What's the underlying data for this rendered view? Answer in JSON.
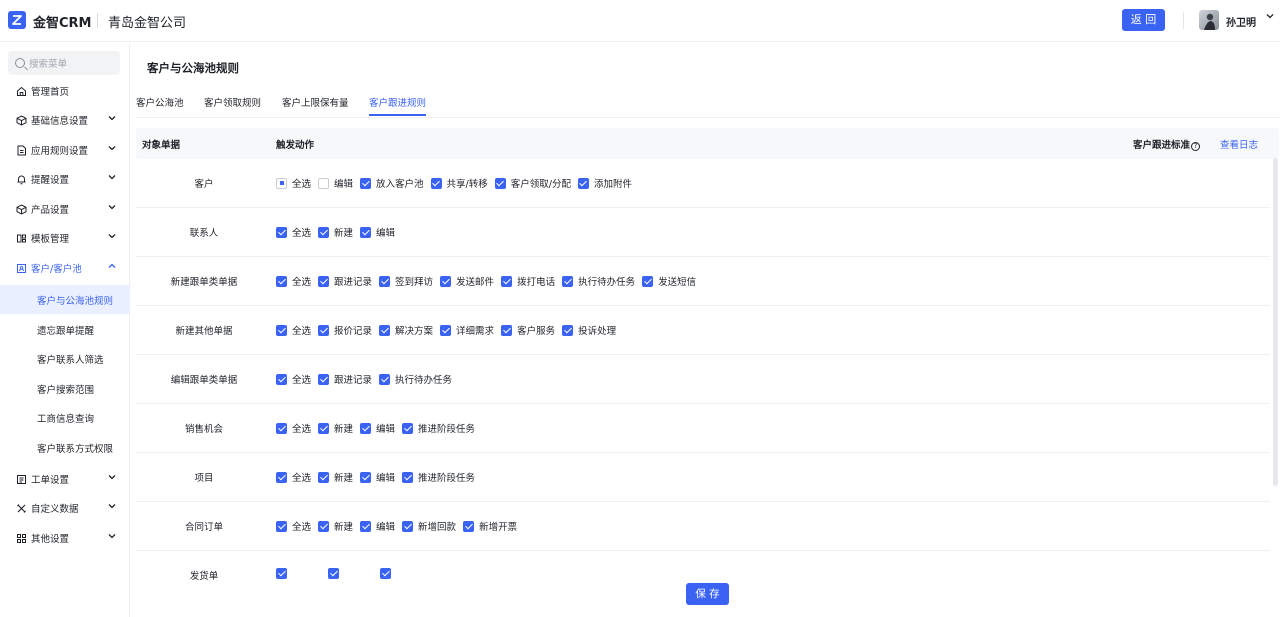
{
  "header": {
    "app_name": "金智CRM",
    "company": "青岛金智公司",
    "back_label": "返 回",
    "user_name": "孙卫明"
  },
  "sidebar": {
    "search_placeholder": "搜索菜单",
    "items": [
      {
        "label": "管理首页",
        "icon": "home-icon",
        "has_chevron": false
      },
      {
        "label": "基础信息设置",
        "icon": "cube-icon",
        "has_chevron": true
      },
      {
        "label": "应用规则设置",
        "icon": "document-icon",
        "has_chevron": true
      },
      {
        "label": "提醒设置",
        "icon": "bell-icon",
        "has_chevron": true
      },
      {
        "label": "产品设置",
        "icon": "box-icon",
        "has_chevron": true
      },
      {
        "label": "模板管理",
        "icon": "template-icon",
        "has_chevron": true
      },
      {
        "label": "客户/客户池",
        "icon": "users-icon",
        "has_chevron": true,
        "open": true
      }
    ],
    "sub_items": [
      {
        "label": "客户与公海池规则",
        "active": true
      },
      {
        "label": "遗忘跟单提醒"
      },
      {
        "label": "客户联系人筛选"
      },
      {
        "label": "客户搜索范围"
      },
      {
        "label": "工商信息查询"
      },
      {
        "label": "客户联系方式权限"
      }
    ],
    "bottom_items": [
      {
        "label": "工单设置",
        "icon": "ticket-icon"
      },
      {
        "label": "自定义数据",
        "icon": "tools-icon"
      },
      {
        "label": "其他设置",
        "icon": "grid-icon"
      }
    ]
  },
  "main": {
    "page_title": "客户与公海池规则",
    "tabs": [
      {
        "label": "客户公海池"
      },
      {
        "label": "客户领取规则"
      },
      {
        "label": "客户上限保有量"
      },
      {
        "label": "客户跟进规则",
        "active": true
      }
    ],
    "table": {
      "col_object": "对象单据",
      "col_action": "触发动作",
      "col_standard": "客户跟进标准",
      "view_log": "查看日志",
      "rows": [
        {
          "label": "客户",
          "actions": [
            {
              "label": "全选",
              "state": "partial"
            },
            {
              "label": "编辑",
              "state": "unchecked"
            },
            {
              "label": "放入客户池",
              "state": "checked"
            },
            {
              "label": "共享/转移",
              "state": "checked"
            },
            {
              "label": "客户领取/分配",
              "state": "checked"
            },
            {
              "label": "添加附件",
              "state": "checked"
            }
          ]
        },
        {
          "label": "联系人",
          "actions": [
            {
              "label": "全选",
              "state": "checked"
            },
            {
              "label": "新建",
              "state": "checked"
            },
            {
              "label": "编辑",
              "state": "checked"
            }
          ]
        },
        {
          "label": "新建跟单类单据",
          "actions": [
            {
              "label": "全选",
              "state": "checked"
            },
            {
              "label": "跟进记录",
              "state": "checked"
            },
            {
              "label": "签到拜访",
              "state": "checked"
            },
            {
              "label": "发送邮件",
              "state": "checked"
            },
            {
              "label": "拨打电话",
              "state": "checked"
            },
            {
              "label": "执行待办任务",
              "state": "checked"
            },
            {
              "label": "发送短信",
              "state": "checked"
            }
          ]
        },
        {
          "label": "新建其他单据",
          "actions": [
            {
              "label": "全选",
              "state": "checked"
            },
            {
              "label": "报价记录",
              "state": "checked"
            },
            {
              "label": "解决方案",
              "state": "checked"
            },
            {
              "label": "详细需求",
              "state": "checked"
            },
            {
              "label": "客户服务",
              "state": "checked"
            },
            {
              "label": "投诉处理",
              "state": "checked"
            }
          ]
        },
        {
          "label": "编辑跟单类单据",
          "actions": [
            {
              "label": "全选",
              "state": "checked"
            },
            {
              "label": "跟进记录",
              "state": "checked"
            },
            {
              "label": "执行待办任务",
              "state": "checked"
            }
          ]
        },
        {
          "label": "销售机会",
          "actions": [
            {
              "label": "全选",
              "state": "checked"
            },
            {
              "label": "新建",
              "state": "checked"
            },
            {
              "label": "编辑",
              "state": "checked"
            },
            {
              "label": "推进阶段任务",
              "state": "checked"
            }
          ]
        },
        {
          "label": "项目",
          "actions": [
            {
              "label": "全选",
              "state": "checked"
            },
            {
              "label": "新建",
              "state": "checked"
            },
            {
              "label": "编辑",
              "state": "checked"
            },
            {
              "label": "推进阶段任务",
              "state": "checked"
            }
          ]
        },
        {
          "label": "合同订单",
          "actions": [
            {
              "label": "全选",
              "state": "checked"
            },
            {
              "label": "新建",
              "state": "checked"
            },
            {
              "label": "编辑",
              "state": "checked"
            },
            {
              "label": "新增回款",
              "state": "checked"
            },
            {
              "label": "新增开票",
              "state": "checked"
            }
          ]
        },
        {
          "label": "发货单",
          "actions": [
            {
              "label": "",
              "state": "checked"
            },
            {
              "label": "",
              "state": "checked"
            },
            {
              "label": "",
              "state": "checked"
            }
          ]
        }
      ]
    },
    "save_label": "保 存"
  },
  "colors": {
    "accent": "#3a63f3",
    "active_bg": "#eaf0ff"
  }
}
